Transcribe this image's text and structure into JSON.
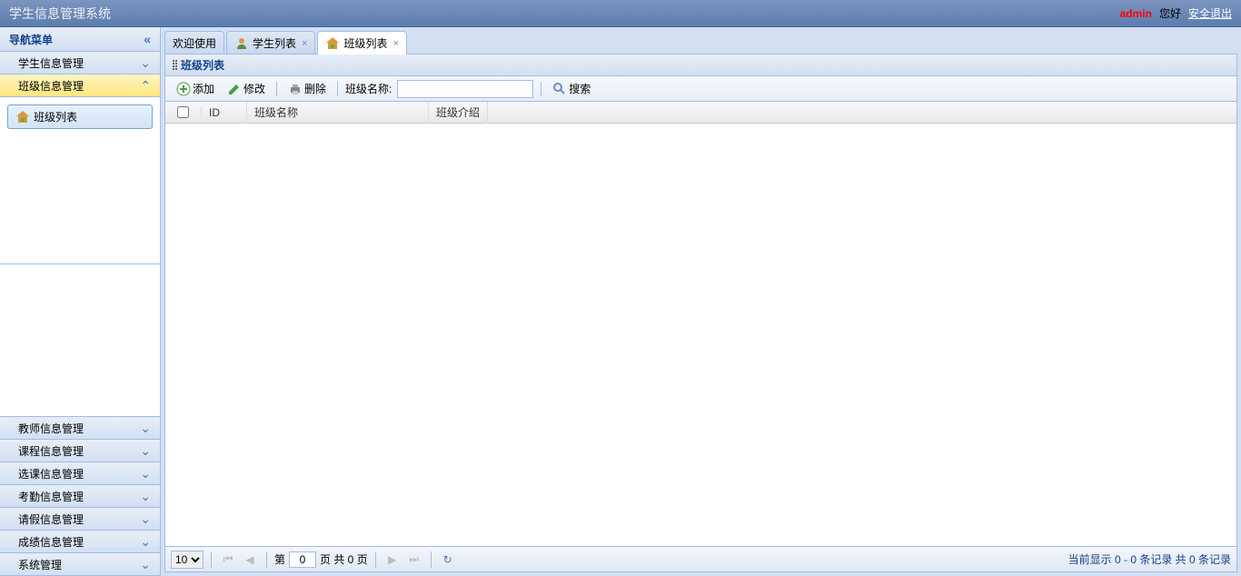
{
  "header": {
    "title": "学生信息管理系统",
    "username": "admin",
    "greeting": "您好",
    "logout": "安全退出"
  },
  "sidebar": {
    "nav_title": "导航菜单",
    "menus": [
      {
        "label": "学生信息管理",
        "expanded": false
      },
      {
        "label": "班级信息管理",
        "expanded": true,
        "items": [
          {
            "label": "班级列表"
          }
        ]
      },
      {
        "label": "教师信息管理",
        "expanded": false
      },
      {
        "label": "课程信息管理",
        "expanded": false
      },
      {
        "label": "选课信息管理",
        "expanded": false
      },
      {
        "label": "考勤信息管理",
        "expanded": false
      },
      {
        "label": "请假信息管理",
        "expanded": false
      },
      {
        "label": "成绩信息管理",
        "expanded": false
      },
      {
        "label": "系统管理",
        "expanded": false
      }
    ]
  },
  "tabs": [
    {
      "label": "欢迎使用",
      "closable": false
    },
    {
      "label": "学生列表",
      "closable": true
    },
    {
      "label": "班级列表",
      "closable": true,
      "active": true
    }
  ],
  "panel": {
    "title": "班级列表"
  },
  "toolbar": {
    "add": "添加",
    "edit": "修改",
    "delete": "删除",
    "search_label": "班级名称:",
    "search": "搜索",
    "search_value": ""
  },
  "grid": {
    "columns": {
      "id": "ID",
      "name": "班级名称",
      "intro": "班级介绍"
    },
    "rows": []
  },
  "pagination": {
    "page_size": "10",
    "page_label_pre": "第",
    "page_num": "0",
    "page_label_post": "页 共 0 页",
    "info": "当前显示 0 - 0 条记录 共 0 条记录"
  }
}
